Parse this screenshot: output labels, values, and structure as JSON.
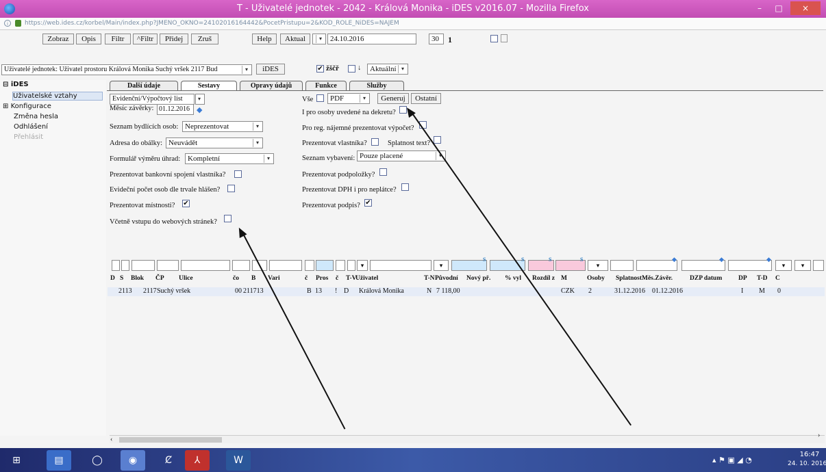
{
  "window": {
    "title": "T - Uživatelé jednotek - 2042 - Králová Monika - iDES v2016.07 - Mozilla Firefox",
    "minimize": "–",
    "maximize": "□",
    "close": "×"
  },
  "url": "https://web.ides.cz/korbel/Main/index.php?JMENO_OKNO=24102016164442&PocetPristupu=2&KOD_ROLE_NiDES=NAJEM",
  "toolbar": {
    "zobraz": "Zobraz",
    "opis": "Opis",
    "filtr": "Filtr",
    "filtr2": "^Filtr",
    "pridej": "Přidej",
    "zrus": "Zruš",
    "help": "Help",
    "aktual": "Aktual",
    "date": "24.10.2016",
    "count": "30",
    "page": "1",
    "context": "Uživatelé jednotek: Uživatel prostoru Králová Monika Suchý vršek 2117 Bud",
    "ides": "iDES",
    "zscr": "žščř",
    "arrow_down": "↓",
    "aktualni": "Aktuální"
  },
  "sidebar": {
    "root": "iDES",
    "items": [
      "Uživatelské vztahy",
      "Konfigurace",
      "Změna hesla",
      "Odhlášení",
      "Přehlásit"
    ]
  },
  "tabs": [
    "Další údaje",
    "Sestavy",
    "Opravy údajů",
    "Funkce",
    "Služby"
  ],
  "form": {
    "report_type": "Evidenční/Výpočtový list",
    "mesic_label": "Měsíc závěrky:",
    "mesic_value": "01.12.2016",
    "seznam_label": "Seznam bydlících osob:",
    "seznam_value": "Neprezentovat",
    "adresa_label": "Adresa do obálky:",
    "adresa_value": "Neuvádět",
    "formular_label": "Formulář výměru úhrad:",
    "formular_value": "Kompletní",
    "bank_label": "Prezentovat bankovní spojení vlastníka?",
    "evidencni_label": "Evideční počet osob dle trvale hlášen?",
    "mistnosti_label": "Prezentovat místnosti?",
    "vcetne_label": "Včetně vstupu do webových stránek?",
    "vse_label": "Vše",
    "format": "PDF",
    "generuj": "Generuj",
    "ostatni": "Ostatní",
    "dekret_label": "I pro osoby uvedené na dekretu?",
    "reg_label": "Pro reg. nájemné prezentovat výpočet?",
    "vlastnika_label": "Prezentovat vlastníka?",
    "splatnost_label": "Splatnost text?",
    "vybaveni_label": "Seznam vybavení:",
    "vybaveni_value": "Pouze placené",
    "podpolozky_label": "Prezentovat podpoložky?",
    "dph_label": "Prezentovat DPH i pro neplátce?",
    "podpis_label": "Prezentovat podpis?",
    "checked_mark": "✔",
    "unchecked_mark": ""
  },
  "grid": {
    "headers": [
      "D",
      "S",
      "Blok",
      "ČP",
      "Ulice",
      "čo",
      "B",
      "Vari",
      "č",
      "Pros",
      "č",
      "T-V",
      "Uživatel",
      "T-N",
      "Původní",
      "Nový př.",
      "% vyl",
      "Rozdíl z",
      "M",
      "Osoby",
      "Splatnost",
      "Měs.Závěr.",
      "DZP datum",
      "DP",
      "T-D",
      "C"
    ],
    "row": [
      "",
      "",
      "2113",
      "2117",
      "Suchý vršek",
      "",
      "00",
      "211713",
      "B",
      "13",
      "!",
      "D",
      "Králová Monika",
      "N",
      "7 118,00",
      "",
      "",
      "",
      "CZK",
      "2",
      "31.12.2016",
      "01.12.2016",
      "",
      "I",
      "M",
      "0"
    ],
    "filter_s": "S",
    "filter_arrow": "▾",
    "diamond": "◆"
  },
  "taskbar": {
    "time": "16:47",
    "date": "24. 10. 2016"
  },
  "colors": {
    "titlebar": "#c24db3",
    "taskbar": "#2b3f85",
    "header_blue": "#cfe8fb",
    "header_pink": "#f9c9dc"
  }
}
